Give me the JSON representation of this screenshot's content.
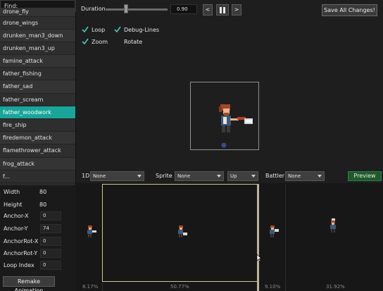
{
  "sidebar": {
    "find_label": "Find:",
    "items": [
      {
        "label": "drone_fly"
      },
      {
        "label": "drone_wings"
      },
      {
        "label": "drunken_man3_down"
      },
      {
        "label": "drunken_man3_up"
      },
      {
        "label": "famine_attack"
      },
      {
        "label": "father_fishing"
      },
      {
        "label": "father_sad"
      },
      {
        "label": "father_scream"
      },
      {
        "label": "father_woodwork",
        "selected": true
      },
      {
        "label": "fire_ship"
      },
      {
        "label": "firedemon_attack"
      },
      {
        "label": "flamethrower_attack"
      },
      {
        "label": "frog_attack"
      },
      {
        "label": "f..."
      }
    ]
  },
  "properties": {
    "width_label": "Width",
    "width_value": "80",
    "height_label": "Height",
    "height_value": "80",
    "anchor_x_label": "Anchor-X",
    "anchor_x_value": "0",
    "anchor_y_label": "Anchor-Y",
    "anchor_y_value": "74",
    "anchor_rot_x_label": "AnchorRot-X",
    "anchor_rot_x_value": "0",
    "anchor_rot_y_label": "AnchorRot-Y",
    "anchor_rot_y_value": "0",
    "loop_index_label": "Loop Index",
    "loop_index_value": "0",
    "remake_label": "Remake Animation"
  },
  "toolbar": {
    "duration_label": "Duration",
    "duration_value": "0.90",
    "duration_slider_fraction": 0.3,
    "prev_label": "<",
    "next_label": ">",
    "save_label": "Save All Changes!"
  },
  "options": {
    "loop_label": "Loop",
    "loop_checked": true,
    "debug_lines_label": "Debug-Lines",
    "debug_lines_checked": true,
    "zoom_label": "Zoom",
    "zoom_checked": true,
    "rotate_label": "Rotate",
    "rotate_checked": false
  },
  "strip_controls": {
    "dir_label": "1D",
    "dir_value": "None",
    "sprite_label": "Sprite",
    "sprite_value": "None",
    "facing_value": "Up",
    "battler_label": "Battler",
    "battler_value": "None",
    "preview_label": "Preview"
  },
  "frames": [
    {
      "percent": "8.17%"
    },
    {
      "percent": "50.77%",
      "selected": true
    },
    {
      "percent": "9.10%"
    },
    {
      "percent": "31.92%"
    }
  ],
  "colors": {
    "selection_teal": "#19a59a",
    "preview_green": "#1f5a2e",
    "frame_selection_border": "#d0c890"
  },
  "icons": {
    "check": "check-icon",
    "pause": "pause-icon",
    "dropdown": "chevron-down-icon",
    "cursor": "mouse-cursor-icon"
  }
}
